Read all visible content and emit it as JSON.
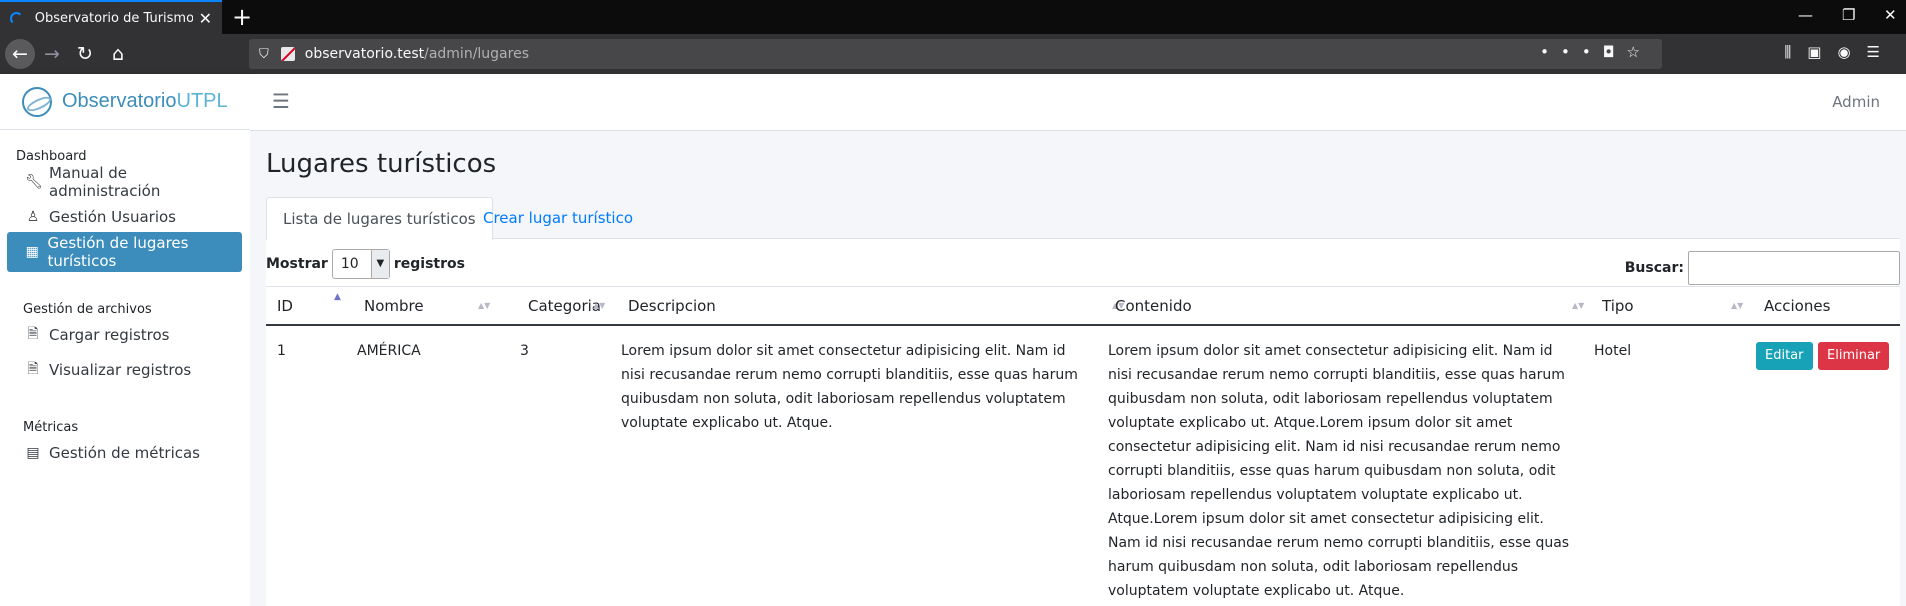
{
  "browser": {
    "tab_title": "Observatorio de Turismo UTPL",
    "url_host": "observatorio.test",
    "url_path": "/admin/lugares"
  },
  "sidebar": {
    "brand_main": "Observatorio",
    "brand_sub": "UTPL",
    "section_dashboard": "Dashboard",
    "items": [
      {
        "label": "Manual de administración",
        "icon": "wrench-icon"
      },
      {
        "label": "Gestión Usuarios",
        "icon": "user-icon"
      },
      {
        "label": "Gestión de lugares turísticos",
        "icon": "building-icon",
        "active": true
      }
    ],
    "section_archivos": "Gestión de archivos",
    "archivos": [
      {
        "label": "Cargar registros",
        "icon": "file-upload-icon"
      },
      {
        "label": "Visualizar registros",
        "icon": "file-view-icon"
      }
    ],
    "section_metricas": "Métricas",
    "metricas": [
      {
        "label": "Gestión de métricas",
        "icon": "calculator-icon"
      }
    ]
  },
  "header": {
    "user": "Admin"
  },
  "main": {
    "title": "Lugares turísticos",
    "tabs": [
      "Lista de lugares turísticos",
      "Crear lugar turístico"
    ],
    "show_label": "Mostrar",
    "show_value": "10",
    "show_suffix": "registros",
    "search_label": "Buscar:",
    "columns": [
      "ID",
      "Nombre",
      "Categoria",
      "Descripcion",
      "Contenido",
      "Tipo",
      "Acciones"
    ],
    "rows": [
      {
        "id": "1",
        "nombre": "AMÉRICA",
        "categoria": "3",
        "descripcion": "Lorem ipsum dolor sit amet consectetur adipisicing elit. Nam id nisi recusandae rerum nemo corrupti blanditiis, esse quas harum quibusdam non soluta, odit laboriosam repellendus voluptatem voluptate explicabo ut. Atque.",
        "contenido": "Lorem ipsum dolor sit amet consectetur adipisicing elit. Nam id nisi recusandae rerum nemo corrupti blanditiis, esse quas harum quibusdam non soluta, odit laboriosam repellendus voluptatem voluptate explicabo ut. Atque.Lorem ipsum dolor sit amet consectetur adipisicing elit. Nam id nisi recusandae rerum nemo corrupti blanditiis, esse quas harum quibusdam non soluta, odit laboriosam repellendus voluptatem voluptate explicabo ut. Atque.Lorem ipsum dolor sit amet consectetur adipisicing elit. Nam id nisi recusandae rerum nemo corrupti blanditiis, esse quas harum quibusdam non soluta, odit laboriosam repellendus voluptatem voluptate explicabo ut. Atque.",
        "tipo": "Hotel",
        "edit_label": "Editar",
        "delete_label": "Eliminar"
      }
    ]
  },
  "colors": {
    "primary": "#3c8dbc",
    "info": "#17a2b8",
    "danger": "#dc3545",
    "link": "#007bff"
  }
}
